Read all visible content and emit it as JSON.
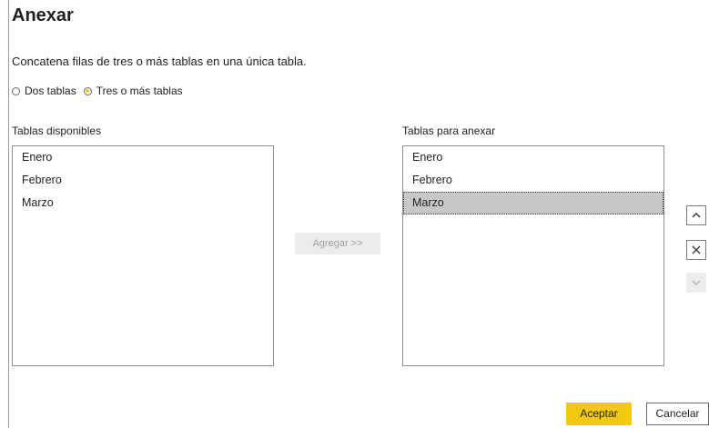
{
  "dialog": {
    "title": "Anexar",
    "description": "Concatena filas de tres o más tablas en una única tabla."
  },
  "mode": {
    "options": [
      {
        "label": "Dos tablas",
        "selected": false
      },
      {
        "label": "Tres o más tablas",
        "selected": true
      }
    ]
  },
  "available": {
    "label": "Tablas disponibles",
    "items": [
      "Enero",
      "Febrero",
      "Marzo"
    ]
  },
  "add_button": {
    "label": "Agregar >>",
    "enabled": false
  },
  "append": {
    "label": "Tablas para anexar",
    "items": [
      "Enero",
      "Febrero",
      "Marzo"
    ],
    "selected_item": "Marzo"
  },
  "side_buttons": {
    "move_up_icon": "chevron-up",
    "remove_icon": "x",
    "move_down_icon": "chevron-down",
    "move_down_enabled": false
  },
  "footer": {
    "ok_label": "Aceptar",
    "cancel_label": "Cancelar"
  },
  "colors": {
    "accent": "#f2c811",
    "selection": "#c8c8c8",
    "disabled_bg": "#ececec"
  }
}
